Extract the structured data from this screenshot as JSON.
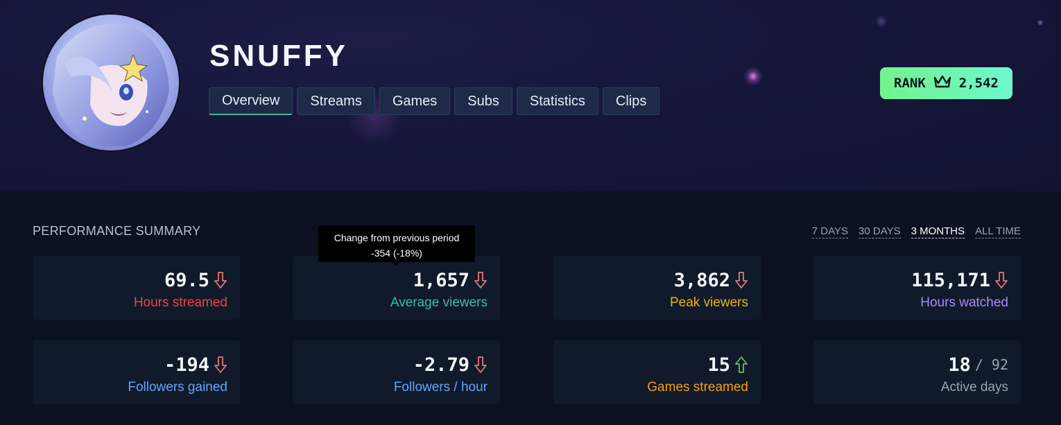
{
  "streamer": {
    "name": "SNUFFY"
  },
  "tabs": [
    {
      "label": "Overview",
      "active": true
    },
    {
      "label": "Streams",
      "active": false
    },
    {
      "label": "Games",
      "active": false
    },
    {
      "label": "Subs",
      "active": false
    },
    {
      "label": "Statistics",
      "active": false
    },
    {
      "label": "Clips",
      "active": false
    }
  ],
  "rank": {
    "label": "RANK",
    "value": "2,542",
    "icon": "crown-icon"
  },
  "summary": {
    "title": "PERFORMANCE SUMMARY",
    "periods": [
      "7 DAYS",
      "30 DAYS",
      "3 MONTHS",
      "ALL TIME"
    ],
    "selected_period": "3 MONTHS"
  },
  "tooltip": {
    "title": "Change from previous period",
    "value": "-354 (-18%)"
  },
  "stats": [
    {
      "value": "69.5",
      "label": "Hours streamed",
      "trend": "down",
      "color": "#ef4444"
    },
    {
      "value": "1,657",
      "label": "Average viewers",
      "trend": "down",
      "color": "#3fb9a2"
    },
    {
      "value": "3,862",
      "label": "Peak viewers",
      "trend": "down",
      "color": "#eab308"
    },
    {
      "value": "115,171",
      "label": "Hours watched",
      "trend": "down",
      "color": "#a78bfa"
    },
    {
      "value": "-194",
      "label": "Followers gained",
      "trend": "down",
      "color": "#60a5fa"
    },
    {
      "value": "-2.79",
      "label": "Followers / hour",
      "trend": "down",
      "color": "#60a5fa"
    },
    {
      "value": "15",
      "label": "Games streamed",
      "trend": "up",
      "color": "#f59e0b"
    },
    {
      "value": "18",
      "suffix": "/ 92",
      "label": "Active days",
      "color": "#9ca3af"
    }
  ],
  "trend_colors": {
    "down": "#e07a7a",
    "up": "#6bbf59"
  }
}
